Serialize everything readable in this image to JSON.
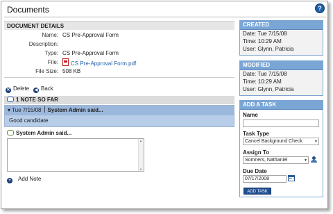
{
  "header": {
    "title": "Documents",
    "help_label": "?"
  },
  "details": {
    "heading": "DOCUMENT DETAILS",
    "fields": [
      {
        "label": "Name:",
        "value": "CS Pre-Approval Form"
      },
      {
        "label": "Description:",
        "value": ""
      },
      {
        "label": "Type:",
        "value": "CS Pre-Approval Form"
      },
      {
        "label": "File:",
        "value": "CS Pre-Approval Form.pdf"
      },
      {
        "label": "File Size:",
        "value": "508 KB"
      }
    ]
  },
  "actions": {
    "delete_label": "Delete",
    "back_label": "Back"
  },
  "notes": {
    "heading": "1 NOTE SO FAR",
    "items": [
      {
        "date": "Tue 7/15/08",
        "author": "System Admin said...",
        "text": "Good candidate"
      }
    ],
    "compose_label": "System Admin said...",
    "add_label": "Add Note"
  },
  "created": {
    "heading": "CREATED",
    "date": "Date: Tue 7/15/08",
    "time": "Time: 10:29 AM",
    "user": "User: Glynn, Patricia"
  },
  "modified": {
    "heading": "MODIFIED",
    "date": "Date: Tue 7/15/08",
    "time": "Time: 10:29 AM",
    "user": "User: Glynn, Patricia"
  },
  "task": {
    "heading": "ADD A TASK",
    "name_label": "Name",
    "name_value": "",
    "type_label": "Task Type",
    "type_value": "Cancel Background Check",
    "assign_label": "Assign To",
    "assign_value": "Somners, Nathaniel",
    "due_label": "Due Date",
    "due_value": "07/17/2008",
    "submit_label": "ADD TASK"
  },
  "colors": {
    "panel_header": "#7aa6d6",
    "note_highlight": "#b7cde8",
    "button": "#1d4e93",
    "link": "#1f5fa8"
  }
}
